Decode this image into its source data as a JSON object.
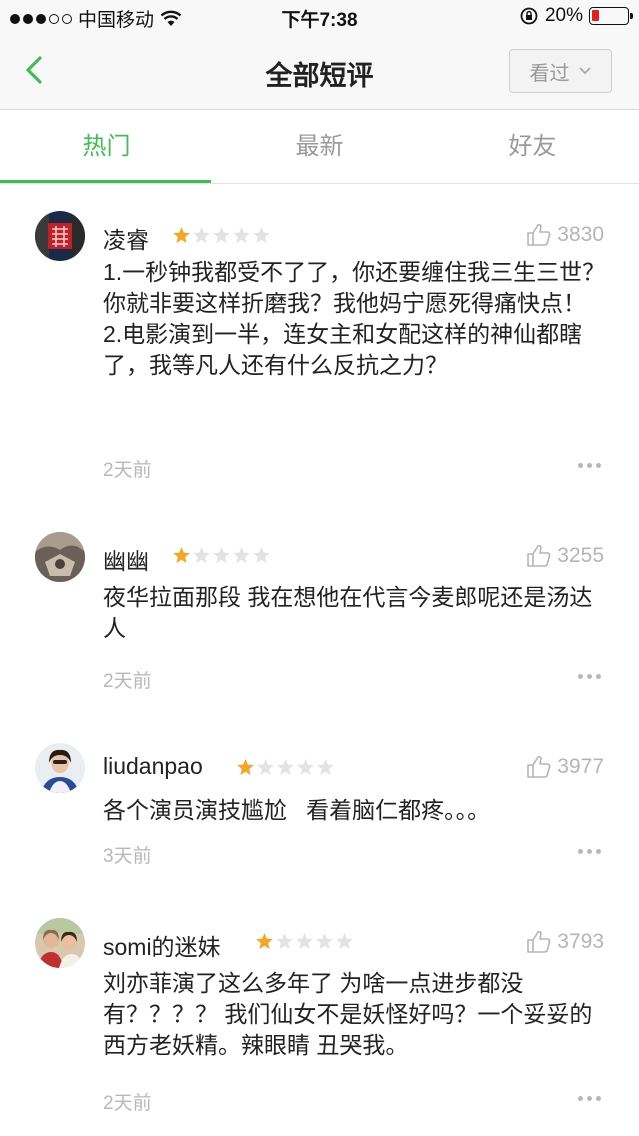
{
  "status_bar": {
    "carrier": "中国移动",
    "time": "下午7:38",
    "battery_percent": "20%",
    "battery_level": 0.2,
    "battery_color": "#e02020"
  },
  "nav": {
    "back_icon": "chevron-left-icon",
    "title": "全部短评",
    "watched_label": "看过",
    "accent_color": "#42bd56"
  },
  "tabs": [
    {
      "label": "热门",
      "active": true
    },
    {
      "label": "最新",
      "active": false
    },
    {
      "label": "好友",
      "active": false
    }
  ],
  "comments": [
    {
      "username": "凌睿",
      "rating": 1,
      "likes": "3830",
      "text": "1.一秒钟我都受不了了，你还要缠住我三生三世？你就非要这样折磨我？我他妈宁愿死得痛快点！ 2.电影演到一半，连女主和女配这样的神仙都瞎了，我等凡人还有什么反抗之力？",
      "time": "2天前",
      "avatar_icon": "double-happiness-avatar",
      "avatar_colors": [
        "#1c2a4a",
        "#c0202a"
      ]
    },
    {
      "username": "幽幽",
      "rating": 1,
      "likes": "3255",
      "text": "夜华拉面那段 我在想他在代言今麦郎呢还是汤达人",
      "time": "2天前",
      "avatar_icon": "landscape-avatar",
      "avatar_colors": [
        "#6a6058",
        "#a89c8c"
      ]
    },
    {
      "username": "liudanpao",
      "rating": 1,
      "likes": "3977",
      "text": "各个演员演技尴尬   看着脑仁都疼。。。",
      "time": "3天前",
      "avatar_icon": "woman-portrait-avatar",
      "avatar_colors": [
        "#e8eef2",
        "#2a4a9a"
      ]
    },
    {
      "username": "somi的迷妹",
      "rating": 1,
      "likes": "3793",
      "text": "刘亦菲演了这么多年了 为啥一点进步都没有？？？？ 我们仙女不是妖怪好吗？一个妥妥的西方老妖精。辣眼睛  丑哭我。",
      "time": "2天前",
      "avatar_icon": "group-photo-avatar",
      "avatar_colors": [
        "#d8c8b0",
        "#8a6a4a"
      ]
    }
  ],
  "star_colors": {
    "filled": "#f5a623",
    "empty": "#e3e3e3"
  }
}
